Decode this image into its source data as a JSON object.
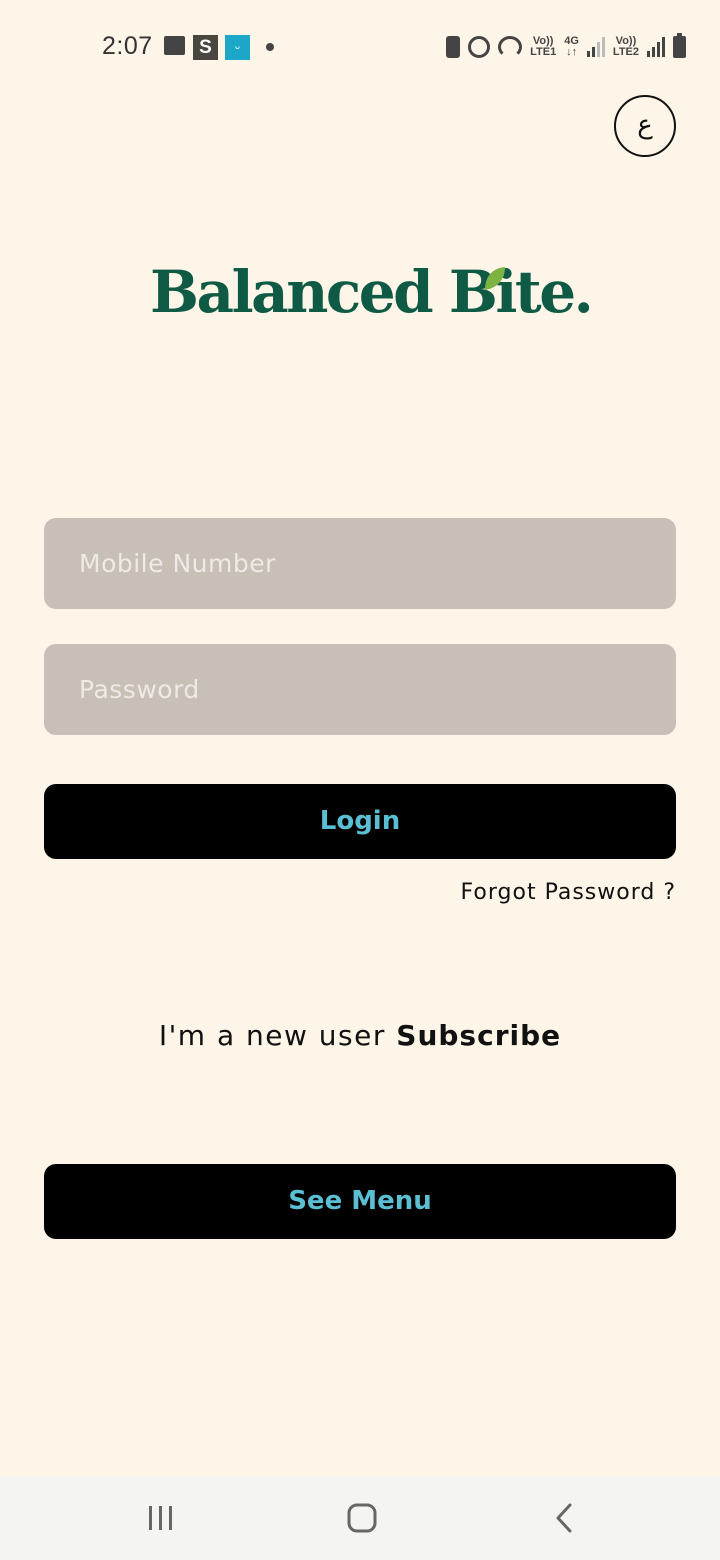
{
  "status_bar": {
    "time": "2:07",
    "app_icon_s": "S",
    "app_icon_u": "ᵕ",
    "network_1_top": "Vo))",
    "network_1_bottom": "LTE1",
    "network_4g_top": "4G",
    "network_4g_bottom": "↓↑",
    "network_2_top": "Vo))",
    "network_2_bottom": "LTE2"
  },
  "language_button": {
    "label": "ع"
  },
  "logo": {
    "text": "Balanced Bite.",
    "brand_color": "#0f5a45",
    "leaf_color": "#7cb342"
  },
  "form": {
    "mobile_placeholder": "Mobile Number",
    "password_placeholder": "Password",
    "login_label": "Login",
    "forgot_password_label": "Forgot Password ?"
  },
  "signup": {
    "prompt": "I'm a new user ",
    "link_label": "Subscribe"
  },
  "see_menu_label": "See Menu",
  "colors": {
    "background": "#fdf5e8",
    "input_bg": "#c8bfb7",
    "button_bg": "#000000",
    "button_text": "#5bbfd4"
  },
  "nav_bar": {
    "recent_icon": "recent-apps-icon",
    "home_icon": "home-icon",
    "back_icon": "back-icon"
  }
}
